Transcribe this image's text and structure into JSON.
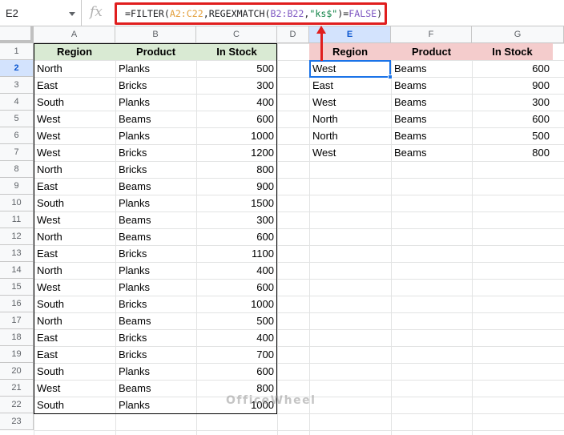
{
  "formula_bar": {
    "name_box": "E2",
    "fx_label": "fx",
    "formula_parts": {
      "p1": "=FILTER(",
      "p2": "A2:C22",
      "p3": ",REGEXMATCH(",
      "p4": "B2:B22",
      "p5": ",",
      "p6": "\"ks$\"",
      "p7": ")=",
      "p8": "FALSE",
      "p9": ")"
    }
  },
  "columns": [
    "A",
    "B",
    "C",
    "D",
    "E",
    "F",
    "G"
  ],
  "rows": [
    "1",
    "2",
    "3",
    "4",
    "5",
    "6",
    "7",
    "8",
    "9",
    "10",
    "11",
    "12",
    "13",
    "14",
    "15",
    "16",
    "17",
    "18",
    "19",
    "20",
    "21",
    "22",
    "23"
  ],
  "source_headers": [
    "Region",
    "Product",
    "In Stock"
  ],
  "source_rows": [
    [
      "North",
      "Planks",
      "500"
    ],
    [
      "East",
      "Bricks",
      "300"
    ],
    [
      "South",
      "Planks",
      "400"
    ],
    [
      "West",
      "Beams",
      "600"
    ],
    [
      "West",
      "Planks",
      "1000"
    ],
    [
      "West",
      "Bricks",
      "1200"
    ],
    [
      "North",
      "Bricks",
      "800"
    ],
    [
      "East",
      "Beams",
      "900"
    ],
    [
      "South",
      "Planks",
      "1500"
    ],
    [
      "West",
      "Beams",
      "300"
    ],
    [
      "North",
      "Beams",
      "600"
    ],
    [
      "East",
      "Bricks",
      "1100"
    ],
    [
      "North",
      "Planks",
      "400"
    ],
    [
      "West",
      "Planks",
      "600"
    ],
    [
      "South",
      "Bricks",
      "1000"
    ],
    [
      "North",
      "Beams",
      "500"
    ],
    [
      "East",
      "Bricks",
      "400"
    ],
    [
      "East",
      "Bricks",
      "700"
    ],
    [
      "South",
      "Planks",
      "600"
    ],
    [
      "West",
      "Beams",
      "800"
    ],
    [
      "South",
      "Planks",
      "1000"
    ]
  ],
  "result_headers": [
    "Region",
    "Product",
    "In Stock"
  ],
  "result_rows": [
    [
      "West",
      "Beams",
      "600"
    ],
    [
      "East",
      "Beams",
      "900"
    ],
    [
      "West",
      "Beams",
      "300"
    ],
    [
      "North",
      "Beams",
      "600"
    ],
    [
      "North",
      "Beams",
      "500"
    ],
    [
      "West",
      "Beams",
      "800"
    ]
  ],
  "watermark": "OfficeWheel",
  "colors": {
    "formula_highlight": "#e01e1e",
    "source_header_fill": "#d9ead3",
    "result_header_fill": "#f4cccc",
    "selection": "#1a73e8"
  }
}
